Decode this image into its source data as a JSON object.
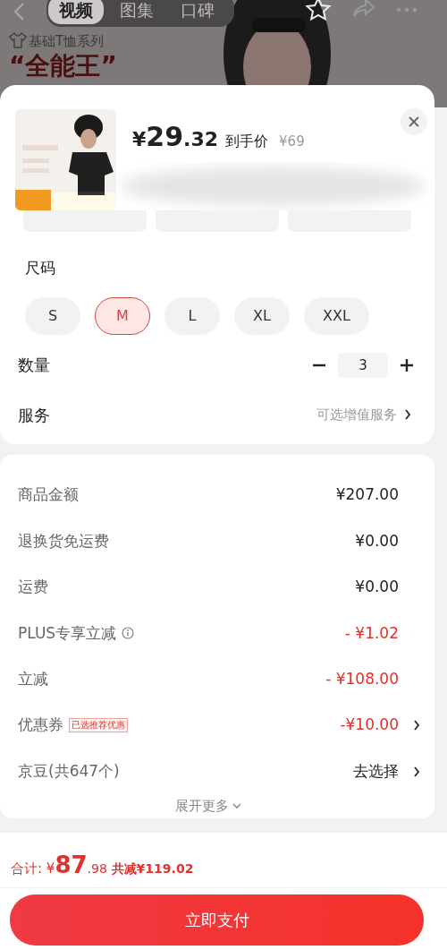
{
  "background": {
    "tabs": [
      {
        "label": "视频",
        "selected": true
      },
      {
        "label": "图集",
        "selected": false
      },
      {
        "label": "口碑",
        "selected": false
      }
    ],
    "series_label": "基础T恤系列",
    "headline": "“全能王”"
  },
  "product": {
    "price_symbol": "¥",
    "price_int": "29",
    "price_dec": ".32",
    "price_label": "到手价",
    "original_price": "¥69"
  },
  "size": {
    "label": "尺码",
    "options": [
      {
        "label": "S",
        "selected": false
      },
      {
        "label": "M",
        "selected": true
      },
      {
        "label": "L",
        "selected": false
      },
      {
        "label": "XL",
        "selected": false
      },
      {
        "label": "XXL",
        "selected": false
      }
    ]
  },
  "quantity": {
    "label": "数量",
    "value": "3"
  },
  "service": {
    "label": "服务",
    "value": "可选增值服务"
  },
  "fees": [
    {
      "label": "商品金额",
      "value": "¥207.00",
      "kind": "plain",
      "link": false
    },
    {
      "label": "退换货免运费",
      "value": "¥0.00",
      "kind": "plain",
      "link": false
    },
    {
      "label": "运费",
      "value": "¥0.00",
      "kind": "plain",
      "link": false
    },
    {
      "label": "PLUS专享立减",
      "info": true,
      "value": "- ¥1.02",
      "kind": "discount",
      "link": false
    },
    {
      "label": "立减",
      "value": "- ¥108.00",
      "kind": "discount",
      "link": false
    },
    {
      "label": "优惠券",
      "tag": "已选推荐优惠",
      "value": "-¥10.00",
      "kind": "discount",
      "link": true
    },
    {
      "label": "京豆(共647个)",
      "value": "去选择",
      "kind": "plain",
      "link": true
    }
  ],
  "expand": "展开更多",
  "total": {
    "label": "合计:",
    "symbol": "¥",
    "int": "87",
    "dec": ".98",
    "saved": "共减¥119.02"
  },
  "pay_button": "立即支付"
}
